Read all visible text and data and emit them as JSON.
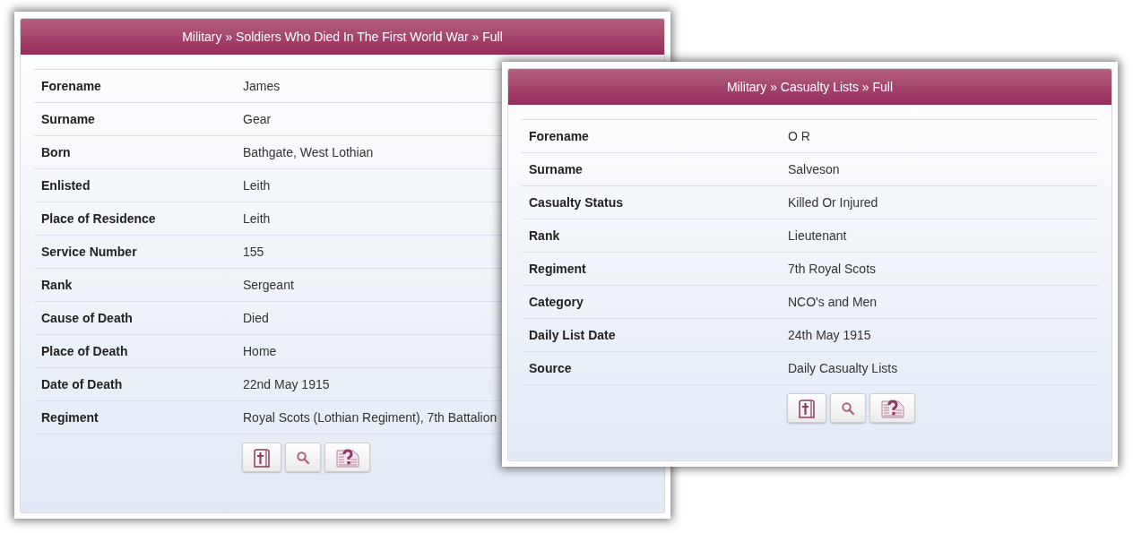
{
  "windows": [
    {
      "title": "Military » Soldiers Who Died In The First World War » Full",
      "rows": [
        {
          "label": "Forename",
          "value": "James"
        },
        {
          "label": "Surname",
          "value": "Gear"
        },
        {
          "label": "Born",
          "value": "Bathgate, West Lothian"
        },
        {
          "label": "Enlisted",
          "value": "Leith"
        },
        {
          "label": "Place of Residence",
          "value": "Leith"
        },
        {
          "label": "Service Number",
          "value": "155"
        },
        {
          "label": "Rank",
          "value": "Sergeant"
        },
        {
          "label": "Cause of Death",
          "value": "Died"
        },
        {
          "label": "Place of Death",
          "value": "Home"
        },
        {
          "label": "Date of Death",
          "value": "22nd May 1915"
        },
        {
          "label": "Regiment",
          "value": "Royal Scots (Lothian Regiment), 7th Battalion"
        }
      ],
      "buttons": [
        {
          "kind": "book"
        },
        {
          "kind": "search"
        },
        {
          "kind": "query"
        }
      ]
    },
    {
      "title": "Military » Casualty Lists » Full",
      "rows": [
        {
          "label": "Forename",
          "value": "O R"
        },
        {
          "label": "Surname",
          "value": "Salveson"
        },
        {
          "label": "Casualty Status",
          "value": "Killed Or Injured"
        },
        {
          "label": "Rank",
          "value": "Lieutenant"
        },
        {
          "label": "Regiment",
          "value": "7th Royal Scots"
        },
        {
          "label": "Category",
          "value": "NCO's and Men"
        },
        {
          "label": "Daily List Date",
          "value": "24th May 1915"
        },
        {
          "label": "Source",
          "value": "Daily Casualty Lists"
        }
      ],
      "buttons": [
        {
          "kind": "book"
        },
        {
          "kind": "search"
        },
        {
          "kind": "query"
        }
      ]
    }
  ]
}
